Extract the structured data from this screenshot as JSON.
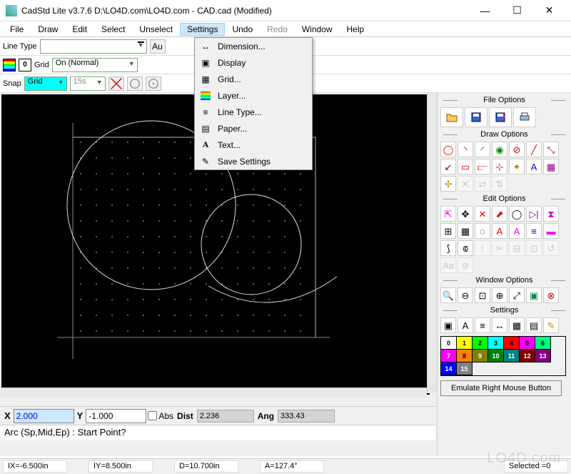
{
  "window": {
    "title": "CadStd Lite v3.7.6  D:\\LO4D.com\\LO4D.com - CAD.cad  (Modified)"
  },
  "menu": {
    "items": [
      "File",
      "Draw",
      "Edit",
      "Select",
      "Unselect",
      "Settings",
      "Undo",
      "Redo",
      "Window",
      "Help"
    ],
    "open_index": 5
  },
  "settings_dropdown": {
    "items": [
      {
        "icon": "dimension",
        "label": "Dimension..."
      },
      {
        "icon": "display",
        "label": "Display"
      },
      {
        "icon": "grid",
        "label": "Grid..."
      },
      {
        "icon": "layer",
        "label": "Layer..."
      },
      {
        "icon": "linetype",
        "label": "Line Type..."
      },
      {
        "icon": "paper",
        "label": "Paper..."
      },
      {
        "icon": "text",
        "label": "Text..."
      },
      {
        "icon": "save",
        "label": "Save Settings"
      }
    ]
  },
  "toolbars": {
    "linetype_label": "Line Type",
    "auto_btn": "Au",
    "layer_num": "0",
    "grid_label": "Grid",
    "grid_mode": "On (Normal)",
    "snap_label": "Snap",
    "snap_mode": "Grid",
    "snap_val": "15s"
  },
  "coords": {
    "x_label": "X",
    "x_val": "2.000",
    "y_label": "Y",
    "y_val": "-1.000",
    "abs_label": "Abs",
    "dist_label": "Dist",
    "dist_val": "2.236",
    "ang_label": "Ang",
    "ang_val": "333.43"
  },
  "prompt": "Arc (Sp,Mid,Ep) : Start Point?",
  "status": {
    "ix": "IX=-6.500in",
    "iy": "IY=8.500in",
    "d": "D=10.700in",
    "a": "A=127.4°",
    "sel": "Selected =0"
  },
  "right": {
    "file_options": "File Options",
    "draw_options": "Draw Options",
    "edit_options": "Edit Options",
    "window_options": "Window Options",
    "settings": "Settings",
    "emulate": "Emulate Right Mouse Button"
  },
  "palette": [
    {
      "n": "0",
      "bg": "#ffffff",
      "fg": "#000"
    },
    {
      "n": "1",
      "bg": "#ffff00",
      "fg": "#000"
    },
    {
      "n": "2",
      "bg": "#00ff00",
      "fg": "#000"
    },
    {
      "n": "3",
      "bg": "#00ffff",
      "fg": "#000"
    },
    {
      "n": "4",
      "bg": "#ff0000",
      "fg": "#000"
    },
    {
      "n": "5",
      "bg": "#ff00ff",
      "fg": "#000"
    },
    {
      "n": "6",
      "bg": "#00ff80",
      "fg": "#000"
    },
    {
      "n": "7",
      "bg": "#ff00ff",
      "fg": "#fff"
    },
    {
      "n": "8",
      "bg": "#ff8000",
      "fg": "#000"
    },
    {
      "n": "9",
      "bg": "#808000",
      "fg": "#fff"
    },
    {
      "n": "10",
      "bg": "#008000",
      "fg": "#fff"
    },
    {
      "n": "11",
      "bg": "#008080",
      "fg": "#fff"
    },
    {
      "n": "12",
      "bg": "#800000",
      "fg": "#fff"
    },
    {
      "n": "13",
      "bg": "#800080",
      "fg": "#fff"
    },
    {
      "n": "14",
      "bg": "#0000ff",
      "fg": "#fff"
    },
    {
      "n": "15",
      "bg": "#808080",
      "fg": "#fff"
    }
  ],
  "watermark": "LO4D.com"
}
